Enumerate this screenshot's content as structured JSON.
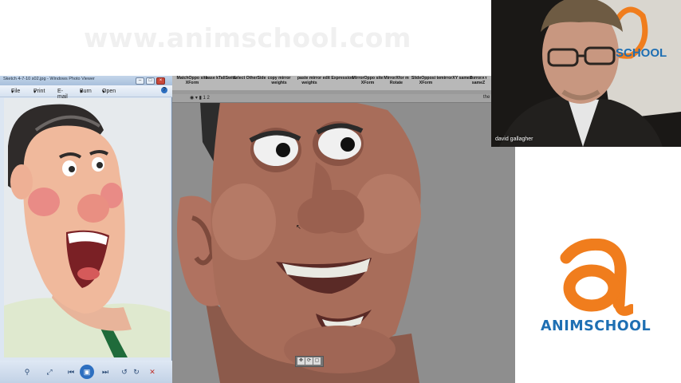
{
  "watermark": {
    "text": "www.animschool.com"
  },
  "photo_viewer": {
    "title": "Sketch 4-7-10 s02.jpg - Windows Photo Viewer",
    "menu": [
      {
        "label": "File",
        "icon": "chevron-down-icon"
      },
      {
        "label": "Print",
        "icon": "chevron-down-icon"
      },
      {
        "label": "E-mail"
      },
      {
        "label": "Burn",
        "icon": "chevron-down-icon"
      },
      {
        "label": "Open",
        "icon": "chevron-down-icon"
      }
    ],
    "bottom_icons": [
      "zoom-icon",
      "fit-window-icon",
      "previous-icon",
      "slideshow-icon",
      "next-icon",
      "rotate-left-icon",
      "rotate-right-icon",
      "delete-icon"
    ]
  },
  "maya_shelf": {
    "buttons": [
      "MatchOppo site XForm",
      "base kTallSwit1",
      "select OtherSide",
      "copy mirror weights",
      "paste mirror weights",
      "edit Expression",
      "MirrorOppo site XForm",
      "MirrorXfor m Rotate",
      "SlideOpposi te XForm",
      "mirrorXY sameZ",
      "mirrorXY sameZ"
    ]
  },
  "viewport": {
    "toolbar_text": "◉ ▾  ▮ 1  2",
    "right_label": "the"
  },
  "webcam": {
    "presenter_name": "david gallagher",
    "bg_logo_text": "SCHOOL"
  },
  "animschool_logo": {
    "anim": "ANIM",
    "school": "SCHOOL",
    "colors": {
      "orange": "#f07d1d",
      "blue": "#1e6fb3"
    }
  }
}
